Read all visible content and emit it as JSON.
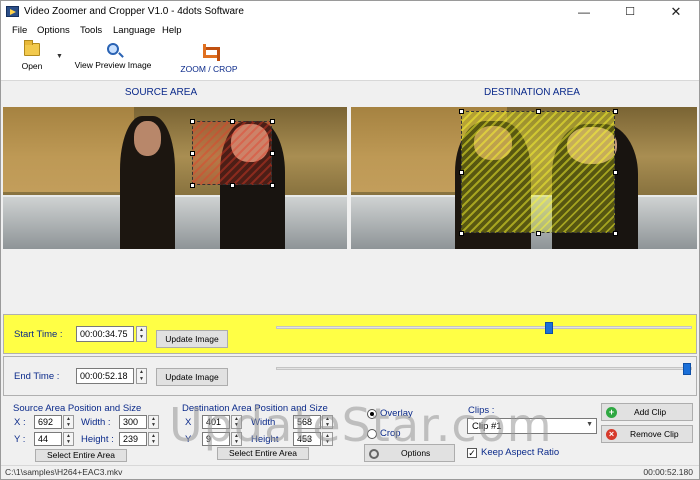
{
  "window": {
    "title": "Video Zoomer and Cropper V1.0 - 4dots Software",
    "minimize": "—",
    "maximize": "☐",
    "close": "✕"
  },
  "menu": [
    "File",
    "Options",
    "Tools",
    "Language",
    "Help"
  ],
  "toolbar": {
    "open": "Open",
    "view_preview": "View Preview Image",
    "zoom_crop": "ZOOM / CROP"
  },
  "panels": {
    "source_title": "SOURCE AREA",
    "destination_title": "DESTINATION AREA"
  },
  "start_time": {
    "label": "Start Time :",
    "value": "00:00:34.75",
    "button": "Update Image",
    "slider_position": 0.66
  },
  "end_time": {
    "label": "End Time :",
    "value": "00:00:52.18",
    "button": "Update Image",
    "slider_position": 1.0
  },
  "source_area": {
    "title": "Source Area Position and Size",
    "x_label": "X :",
    "x": "692",
    "y_label": "Y :",
    "y": "44",
    "width_label": "Width :",
    "width": "300",
    "height_label": "Height :",
    "height": "239",
    "select_button": "Select Entire Area"
  },
  "destination_area": {
    "title": "Destination Area Position and Size",
    "x_label": "X",
    "x": "401",
    "y_label": "Y",
    "y": "9",
    "width_label": "Width",
    "width": "568",
    "height_label": "Height",
    "height": "453",
    "select_button": "Select Entire Area"
  },
  "mode": {
    "overlay": "Overlay",
    "crop": "Crop",
    "options_button": "Options",
    "selected": "overlay"
  },
  "clips": {
    "label": "Clips :",
    "selected": "Clip #1",
    "add_button": "Add Clip",
    "remove_button": "Remove Clip",
    "keep_aspect": "Keep Aspect Ratio",
    "keep_aspect_checked": true
  },
  "watermark": "UpdateStar.com",
  "status": {
    "file": "C:\\1\\samples\\H264+EAC3.mkv",
    "duration": "00:00:52.180"
  }
}
